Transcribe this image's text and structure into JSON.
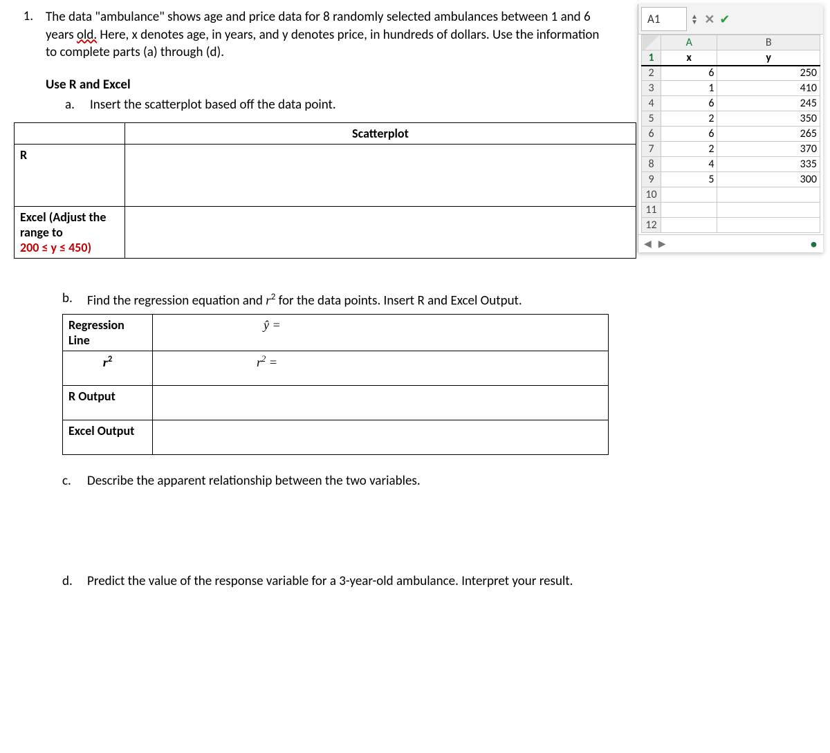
{
  "question": {
    "number": "1.",
    "intro_pre": "The data \"ambulance\" shows age and price data for 8 randomly selected ambulances between 1 and 6 years ",
    "intro_underlined": "old.",
    "intro_post": "  Here, x denotes age, in years, and y denotes price, in hundreds of dollars. Use the information to complete parts (a) through (d).",
    "use_line": "Use R and Excel",
    "parts": {
      "a": {
        "letter": "a.",
        "text": "Insert the scatterplot based off the data point."
      },
      "b": {
        "letter": "b.",
        "text_pre": "Find the regression equation and ",
        "r2": "r",
        "text_post": " for the data points.  Insert R and Excel Output."
      },
      "c": {
        "letter": "c.",
        "text": "Describe the apparent relationship between the two variables."
      },
      "d": {
        "letter": "d.",
        "text": "Predict the value of the response variable for a 3-year-old ambulance.  Interpret your result."
      }
    }
  },
  "table_a": {
    "scatter_header": "Scatterplot",
    "row_r": "R",
    "row_excel_pre": "Excel (Adjust the range to",
    "row_excel_range": "200 ≤ y ≤ 450)"
  },
  "table_b": {
    "reg_label": "Regression Line",
    "yhat": "ŷ =",
    "r2_label": "r",
    "r2_eq": " =",
    "r_output": "R Output",
    "excel_output": "Excel Output"
  },
  "excel": {
    "name_box": "A1",
    "col_a_header": "A",
    "col_b_header": "B",
    "headers": {
      "x": "x",
      "y": "y"
    },
    "rows": [
      {
        "n": "1"
      },
      {
        "n": "2",
        "a": "6",
        "b": "250"
      },
      {
        "n": "3",
        "a": "1",
        "b": "410"
      },
      {
        "n": "4",
        "a": "6",
        "b": "245"
      },
      {
        "n": "5",
        "a": "2",
        "b": "350"
      },
      {
        "n": "6",
        "a": "6",
        "b": "265"
      },
      {
        "n": "7",
        "a": "2",
        "b": "370"
      },
      {
        "n": "8",
        "a": "4",
        "b": "335"
      },
      {
        "n": "9",
        "a": "5",
        "b": "300"
      },
      {
        "n": "10"
      },
      {
        "n": "11"
      },
      {
        "n": "12"
      }
    ]
  },
  "chart_data": {
    "type": "table",
    "title": "ambulance data",
    "columns": [
      "x (age, years)",
      "y (price, $100s)"
    ],
    "rows": [
      [
        6,
        250
      ],
      [
        1,
        410
      ],
      [
        6,
        245
      ],
      [
        2,
        350
      ],
      [
        6,
        265
      ],
      [
        2,
        370
      ],
      [
        4,
        335
      ],
      [
        5,
        300
      ]
    ]
  }
}
